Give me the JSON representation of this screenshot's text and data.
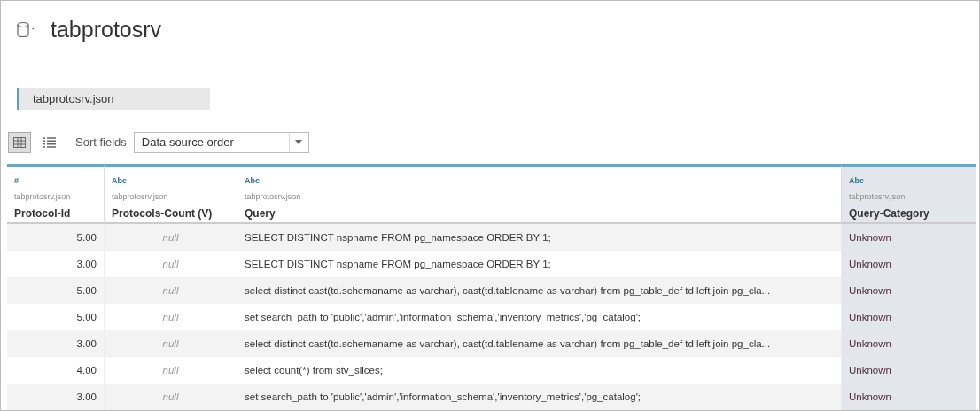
{
  "title": "tabprotosrv",
  "connection": {
    "label": "tabprotosrv.json"
  },
  "toolbar": {
    "views": [
      {
        "kind": "grid",
        "selected": true
      },
      {
        "kind": "list",
        "selected": false
      }
    ],
    "sort_label": "Sort fields",
    "sort_value": "Data source order"
  },
  "table": {
    "columns": [
      {
        "type_label": "#",
        "source": "tabprotosrv.json",
        "name": "Protocol-Id",
        "kind": "number",
        "selected": false
      },
      {
        "type_label": "Abc",
        "source": "tabprotosrv.json",
        "name": "Protocols-Count (V)",
        "kind": "null",
        "selected": false
      },
      {
        "type_label": "Abc",
        "source": "tabprotosrv.json",
        "name": "Query",
        "kind": "text",
        "selected": false
      },
      {
        "type_label": "Abc",
        "source": "tabprotosrv.json",
        "name": "Query-Category",
        "kind": "text",
        "selected": true
      }
    ],
    "rows": [
      [
        "5.00",
        "null",
        "SELECT DISTINCT nspname FROM pg_namespace ORDER BY 1;",
        "Unknown"
      ],
      [
        "3.00",
        "null",
        "SELECT DISTINCT nspname FROM pg_namespace ORDER BY 1;",
        "Unknown"
      ],
      [
        "5.00",
        "null",
        "select distinct cast(td.schemaname as varchar), cast(td.tablename as varchar) from pg_table_def td left join pg_cla...",
        "Unknown"
      ],
      [
        "5.00",
        "null",
        "set search_path to 'public','admin','information_schema','inventory_metrics','pg_catalog';",
        "Unknown"
      ],
      [
        "3.00",
        "null",
        "select distinct cast(td.schemaname as varchar), cast(td.tablename as varchar) from pg_table_def td left join pg_cla...",
        "Unknown"
      ],
      [
        "4.00",
        "null",
        "select count(*) from stv_slices;",
        "Unknown"
      ],
      [
        "3.00",
        "null",
        "set search_path to 'public','admin','information_schema','inventory_metrics','pg_catalog';",
        "Unknown"
      ]
    ]
  }
}
